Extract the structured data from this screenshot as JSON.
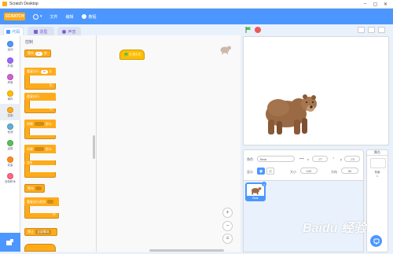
{
  "window": {
    "title": "Scratch Desktop",
    "min": "–",
    "max": "▢",
    "close": "✕"
  },
  "menubar": {
    "logo": "SCRATCH",
    "file": "文件",
    "edit": "编辑",
    "tutorials": "教程"
  },
  "tabs": {
    "code": "代码",
    "costumes": "造型",
    "sounds": "声音"
  },
  "categories": [
    {
      "label": "运动",
      "color": "#4c97ff"
    },
    {
      "label": "外观",
      "color": "#9966ff"
    },
    {
      "label": "声音",
      "color": "#cf63cf"
    },
    {
      "label": "事件",
      "color": "#ffbf00"
    },
    {
      "label": "控制",
      "color": "#ffab19"
    },
    {
      "label": "侦测",
      "color": "#5cb1d6"
    },
    {
      "label": "运算",
      "color": "#59c059"
    },
    {
      "label": "变量",
      "color": "#ff8c1a"
    },
    {
      "label": "自制积木",
      "color": "#ff6680"
    }
  ],
  "palette": {
    "title": "控制",
    "wait_prefix": "等待",
    "wait_value": "1",
    "wait_suffix": "秒",
    "repeat_prefix": "重复执行",
    "repeat_value": "10",
    "repeat_suffix": "次",
    "forever": "重复执行",
    "if_prefix": "如果",
    "if_suffix": "那么",
    "else": "否则",
    "wait_until": "等待",
    "repeat_until": "重复执行直到",
    "stop": "停止",
    "stop_option": "全部脚本"
  },
  "script": {
    "hat_label": "当 被点击"
  },
  "sprite_info": {
    "sprite_label": "角色",
    "sprite_name": "Bear",
    "x_value": "-77",
    "y_value": "-73",
    "show_label": "显示",
    "size_label": "大小",
    "size_value": "100",
    "direction_label": "方向",
    "direction_value": "90"
  },
  "sprite_card": {
    "name": "Bear"
  },
  "stage_panel": {
    "title": "舞台",
    "backdrops_label": "背景",
    "backdrops_count": "1"
  },
  "zoom": {
    "in": "+",
    "out": "−",
    "reset": "="
  },
  "watermark": "Baidu 经验",
  "colors": {
    "accent": "#4c97ff",
    "control": "#ffab19",
    "events": "#ffbf00"
  },
  "icons": [
    "flag-icon",
    "stop-icon",
    "globe-icon",
    "bulb-icon",
    "paint-icon",
    "speaker-icon",
    "eye-icon",
    "add-sprite-icon",
    "extension-icon"
  ]
}
